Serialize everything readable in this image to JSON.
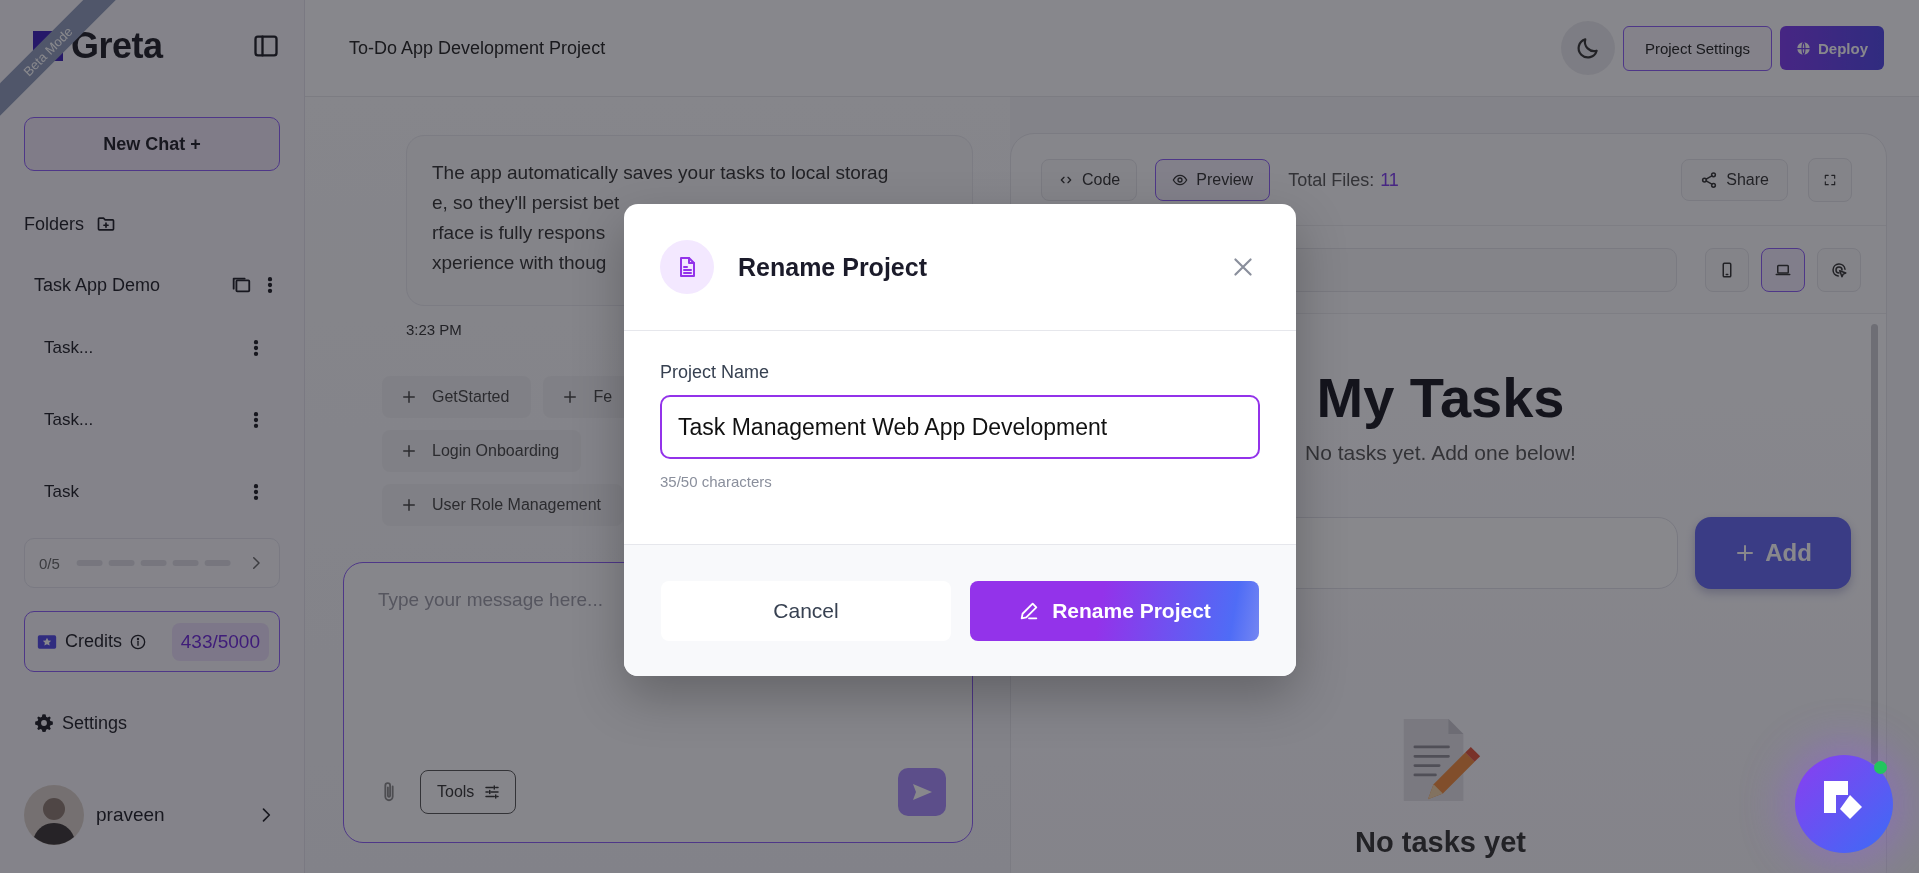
{
  "sidebar": {
    "logo": "Greta",
    "ribbon": "Beta Mode",
    "new_chat": "New Chat +",
    "folders_label": "Folders",
    "folders": [
      {
        "name": "Task App Demo",
        "children": [
          {
            "name": "Task..."
          },
          {
            "name": "Task..."
          },
          {
            "name": "Task"
          }
        ]
      }
    ],
    "progress": {
      "text": "0/5"
    },
    "credits": {
      "label": "Credits",
      "value": "433/5000"
    },
    "settings": "Settings",
    "user": {
      "name": "praveen"
    }
  },
  "header": {
    "title": "To-Do App Development Project",
    "buttons": [
      {
        "kind": "outline",
        "label": "Project Settings"
      },
      {
        "kind": "primary",
        "label": "Deploy"
      }
    ]
  },
  "chat": {
    "message_lines": [
      "The app automatically saves your tasks to local storag",
      "e, so they'll persist bet",
      "rface is fully respons",
      "xperience with thoug"
    ],
    "time": "3:23 PM",
    "suggestion_rows": [
      [
        "GetStarted",
        "Fe"
      ],
      [
        "Login Onboarding"
      ],
      [
        "User Role Management"
      ]
    ],
    "input": {
      "placeholder": "Type your message here..."
    },
    "tools": "Tools"
  },
  "preview": {
    "tabs": [
      {
        "label": "Code",
        "kind": "code",
        "selected": false
      },
      {
        "label": "Preview",
        "kind": "preview",
        "selected": true
      }
    ],
    "total_files_label": "Total Files:",
    "total_files": "11",
    "share": "Share",
    "devices": [
      {
        "kind": "mobile",
        "selected": false
      },
      {
        "kind": "laptop",
        "selected": true
      },
      {
        "kind": "inspect",
        "selected": false
      }
    ],
    "app": {
      "title": "My Tasks",
      "subtitle": "No tasks yet. Add one below!",
      "add_button": "Add",
      "empty_title": "No tasks yet"
    }
  },
  "dialog": {
    "title": "Rename Project",
    "field_label": "Project Name",
    "value": "Task Management Web App Development",
    "hint": "35/50 characters",
    "cancel": "Cancel",
    "confirm": "Rename Project"
  }
}
